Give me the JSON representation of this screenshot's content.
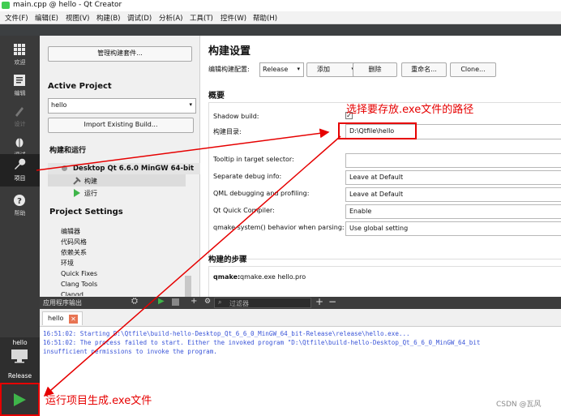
{
  "window": {
    "title": "main.cpp @ hello - Qt Creator"
  },
  "menu": [
    "文件(F)",
    "编辑(E)",
    "视图(V)",
    "构建(B)",
    "调试(D)",
    "分析(A)",
    "工具(T)",
    "控件(W)",
    "帮助(H)"
  ],
  "modes": {
    "welcome": "欢迎",
    "edit": "编辑",
    "design": "设计",
    "debug": "调试",
    "projects": "项目",
    "help": "帮助"
  },
  "kit_selector": {
    "project": "hello",
    "mode": "Release"
  },
  "left": {
    "manage_kits": "管理构建套件...",
    "active_project_heading": "Active Project",
    "project_value": "hello",
    "import_button": "Import Existing Build...",
    "build_run_heading": "构建和运行",
    "kit_name": "Desktop Qt 6.6.0 MinGW 64-bit",
    "build_item": "构建",
    "run_item": "运行",
    "settings_heading": "Project Settings",
    "settings_items": [
      "编辑器",
      "代码风格",
      "依赖关系",
      "环境",
      "Quick Fixes",
      "Clang Tools",
      "Clangd"
    ]
  },
  "right": {
    "title": "构建设置",
    "edit_config_label": "编辑构建配置:",
    "config_value": "Release",
    "add_button": "添加",
    "delete_button": "删除",
    "rename_button": "重命名...",
    "clone_button": "Clone...",
    "overview": "概要",
    "shadow_build_label": "Shadow build:",
    "shadow_build_checked": "✓",
    "build_dir_label": "构建目录:",
    "build_dir_value": "D:\\Qtfile\\hello",
    "tooltip_label": "Tooltip in target selector:",
    "tooltip_value": "",
    "separate_debug_label": "Separate debug info:",
    "separate_debug_value": "Leave at Default",
    "qml_debug_label": "QML debugging and profiling:",
    "qml_debug_value": "Leave at Default",
    "qt_quick_label": "Qt Quick Compiler:",
    "qt_quick_value": "Enable",
    "qmake_behavior_label": "qmake system() behavior when parsing:",
    "qmake_behavior_value": "Use global setting",
    "build_steps_heading": "构建的步骤",
    "qmake_step_label": "qmake:",
    "qmake_step_value": "qmake.exe hello.pro"
  },
  "output": {
    "pane_title": "应用程序输出",
    "filter_placeholder": "过滤器",
    "tab_label": "hello",
    "lines": [
      "16:51:02: Starting D:\\Qtfile\\build-hello-Desktop_Qt_6_6_0_MinGW_64_bit-Release\\release\\hello.exe...",
      "16:51:02: The process failed to start. Either the invoked program \"D:\\Qtfile\\build-hello-Desktop_Qt_6_6_0_MinGW_64_bit",
      "insufficient permissions to invoke the program."
    ]
  },
  "annotations": {
    "path_note": "选择要存放.exe文件的路径",
    "run_note": "运行项目生成.exe文件",
    "watermark": "CSDN @瓦风"
  },
  "colors": {
    "annotation": "#e60000",
    "output_text": "#3a55d8",
    "run_green": "#3fb54a",
    "sidebar": "#3a3a3a"
  }
}
